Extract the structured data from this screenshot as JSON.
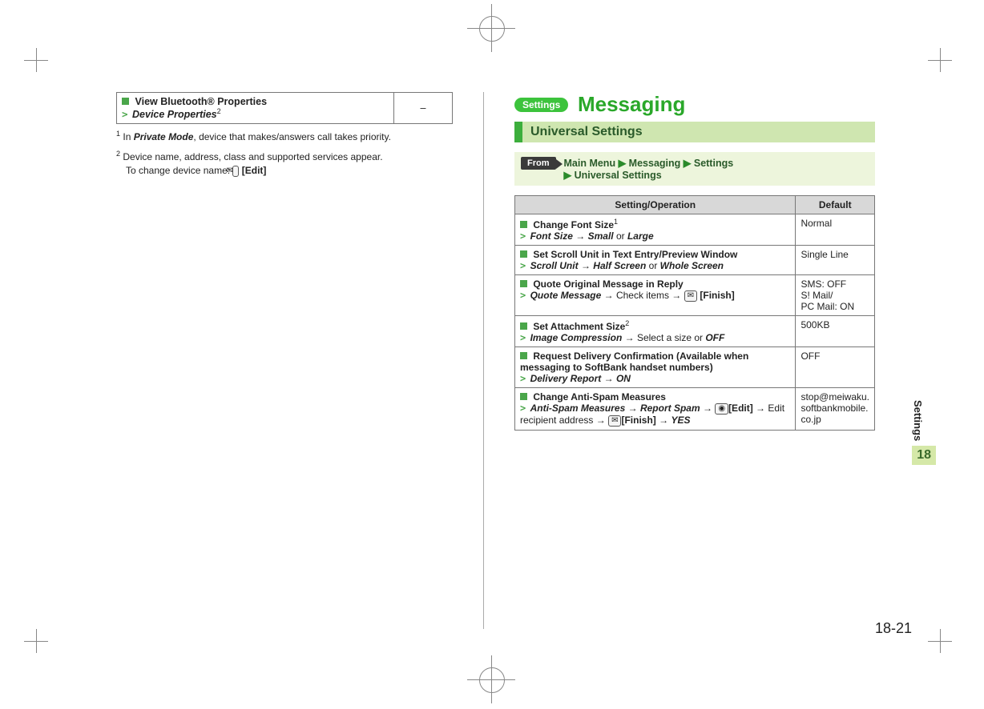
{
  "left": {
    "bt_table": {
      "title": "View Bluetooth® Properties",
      "op_prefix": "Device Properties",
      "op_sup": "2",
      "default": "–"
    },
    "footnote1": {
      "num": "1",
      "pre": "In ",
      "mode": "Private Mode",
      "post": ", device that makes/answers call takes priority."
    },
    "footnote2": {
      "num": "2",
      "line1": "Device name, address, class and supported services appear.",
      "line2_pre": "To change device name: ",
      "key_icon": "✉",
      "key_label": "[Edit]"
    }
  },
  "right": {
    "badge": "Settings",
    "title": "Messaging",
    "subbar": "Universal Settings",
    "from_label": "From",
    "from_path_parts": [
      "Main Menu",
      "Messaging",
      "Settings",
      "Universal Settings"
    ],
    "table": {
      "headers": {
        "setting": "Setting/Operation",
        "default": "Default"
      },
      "rows": [
        {
          "title": "Change Font Size",
          "title_sup": "1",
          "op": "Font Size",
          "arrow": "→",
          "tail_italic1": "Small",
          "tail_plain": " or ",
          "tail_italic2": "Large",
          "default": "Normal"
        },
        {
          "title": "Set Scroll Unit in Text Entry/Preview Window",
          "title_sup": "",
          "op": "Scroll Unit",
          "arrow": "→",
          "tail_italic1": "Half Screen",
          "tail_plain": " or ",
          "tail_italic2": "Whole Screen",
          "default": "Single Line"
        },
        {
          "title": "Quote Original Message in Reply",
          "title_sup": "",
          "op": "Quote Message",
          "arrow": "→",
          "tail_plain_full": " Check items → ",
          "key_icon": "✉",
          "key_label": "[Finish]",
          "default": "SMS: OFF\nS! Mail/\nPC Mail: ON"
        },
        {
          "title": "Set Attachment Size",
          "title_sup": "2",
          "op": "Image Compression",
          "arrow": "→",
          "tail_plain_full": " Select a size or ",
          "tail_bold": "OFF",
          "default": "500KB"
        },
        {
          "title": "Request Delivery Confirmation (Available when messaging to SoftBank handset numbers)",
          "title_sup": "",
          "op": "Delivery Report",
          "arrow": "→",
          "tail_italic1": "ON",
          "default": "OFF"
        },
        {
          "title": "Change Anti-Spam Measures",
          "title_sup": "",
          "op": "Anti-Spam Measures",
          "arrow": "→",
          "tail_spam1": "Report Spam",
          "tail_spam_arrow": " → ",
          "key1_icon": "◉",
          "key1_label": "[Edit]",
          "tail_spam2": " → Edit recipient address → ",
          "key2_icon": "✉",
          "key2_label": "[Finish]",
          "tail_spam3": " → ",
          "tail_yes": "YES",
          "default": "stop@meiwaku.\nsoftbankmobile.\nco.jp"
        }
      ]
    }
  },
  "thumb": {
    "label": "Settings",
    "chapter": "18"
  },
  "page_number": "18-21"
}
